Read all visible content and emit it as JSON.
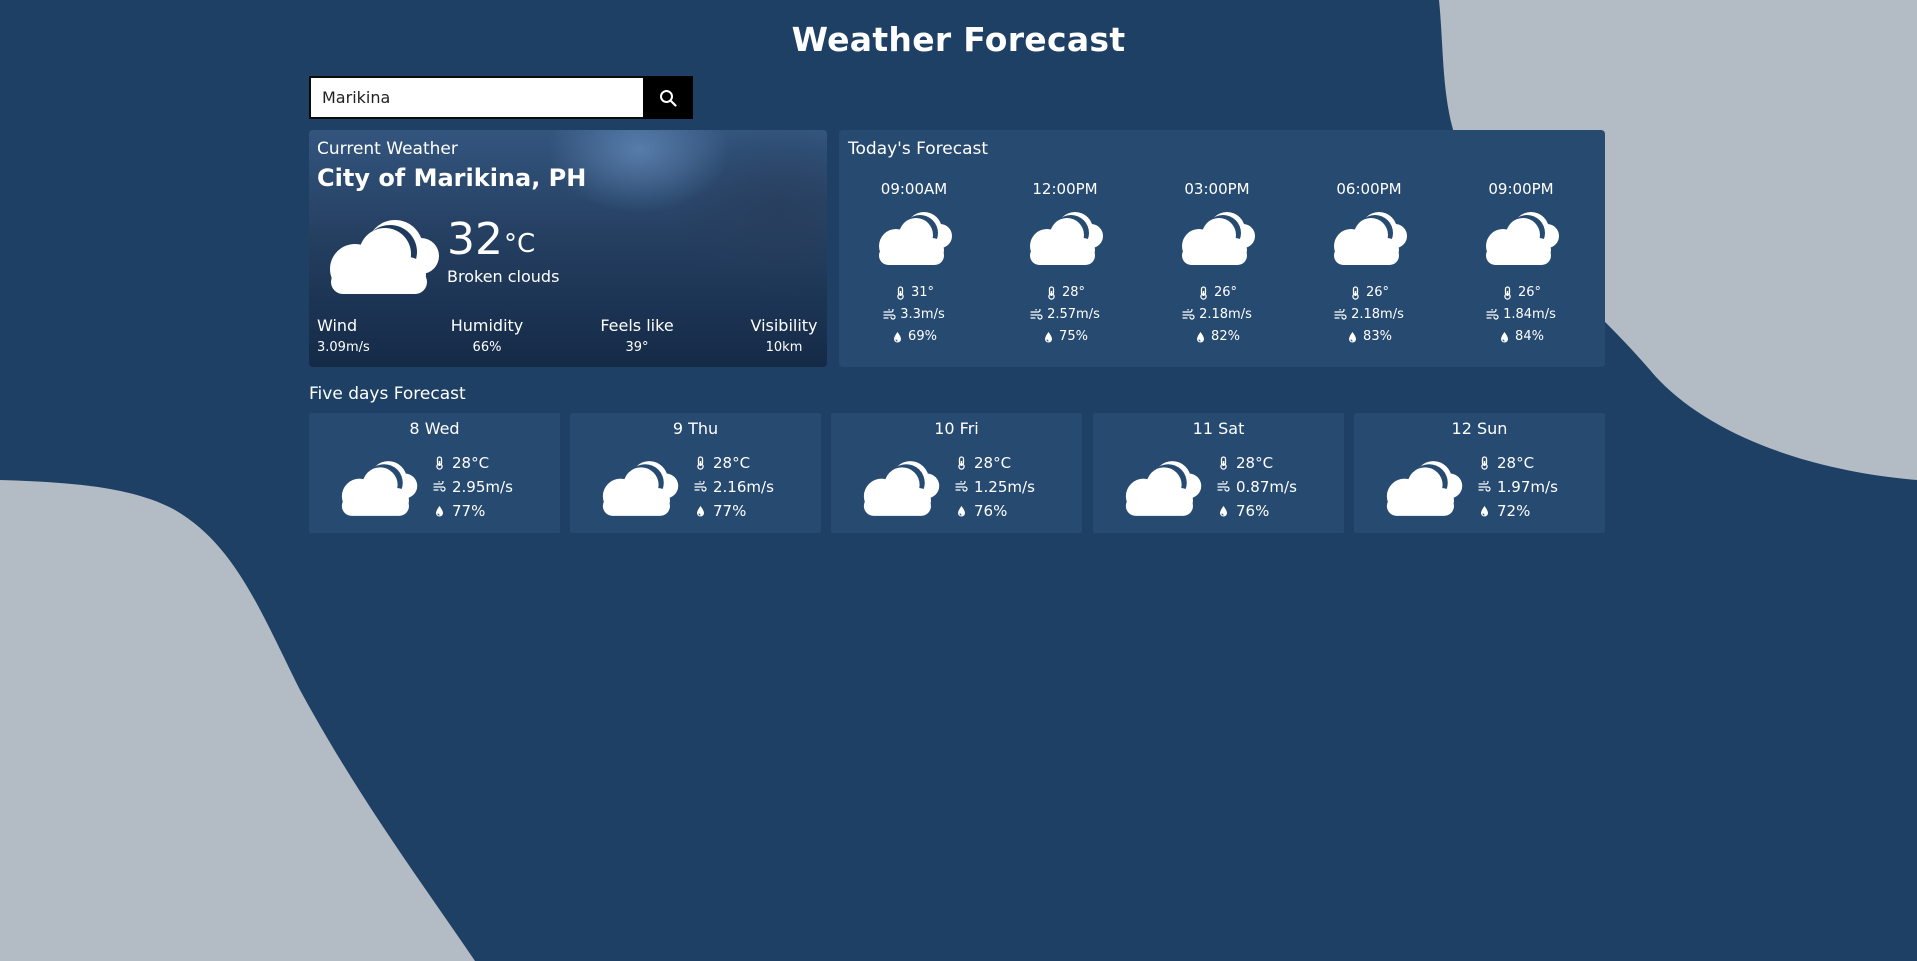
{
  "app": {
    "title": "Weather Forecast",
    "colors": {
      "background": "#1e4064",
      "card": "#274a71",
      "blob": "#b3bcc5",
      "search_button": "#000000"
    }
  },
  "search": {
    "value": "Marikina",
    "placeholder": "",
    "button_icon": "search-icon"
  },
  "current": {
    "label": "Current Weather",
    "city": "City of Marikina, PH",
    "temp": "32",
    "unit": "°C",
    "description": "Broken clouds",
    "icon": "broken-clouds-icon",
    "stats": [
      {
        "label": "Wind",
        "value": "3.09m/s"
      },
      {
        "label": "Humidity",
        "value": "66%"
      },
      {
        "label": "Feels like",
        "value": "39°"
      },
      {
        "label": "Visibility",
        "value": "10km"
      }
    ]
  },
  "today": {
    "title": "Today's Forecast",
    "hours": [
      {
        "time": "09:00AM",
        "temp": "31°",
        "wind": "3.3m/s",
        "humidity": "69%"
      },
      {
        "time": "12:00PM",
        "temp": "28°",
        "wind": "2.57m/s",
        "humidity": "75%"
      },
      {
        "time": "03:00PM",
        "temp": "26°",
        "wind": "2.18m/s",
        "humidity": "82%"
      },
      {
        "time": "06:00PM",
        "temp": "26°",
        "wind": "2.18m/s",
        "humidity": "83%"
      },
      {
        "time": "09:00PM",
        "temp": "26°",
        "wind": "1.84m/s",
        "humidity": "84%"
      }
    ]
  },
  "five_days": {
    "title": "Five days Forecast",
    "days": [
      {
        "day": "8 Wed",
        "temp": "28°C",
        "wind": "2.95m/s",
        "humidity": "77%"
      },
      {
        "day": "9 Thu",
        "temp": "28°C",
        "wind": "2.16m/s",
        "humidity": "77%"
      },
      {
        "day": "10 Fri",
        "temp": "28°C",
        "wind": "1.25m/s",
        "humidity": "76%"
      },
      {
        "day": "11 Sat",
        "temp": "28°C",
        "wind": "0.87m/s",
        "humidity": "76%"
      },
      {
        "day": "12 Sun",
        "temp": "28°C",
        "wind": "1.97m/s",
        "humidity": "72%"
      }
    ]
  }
}
